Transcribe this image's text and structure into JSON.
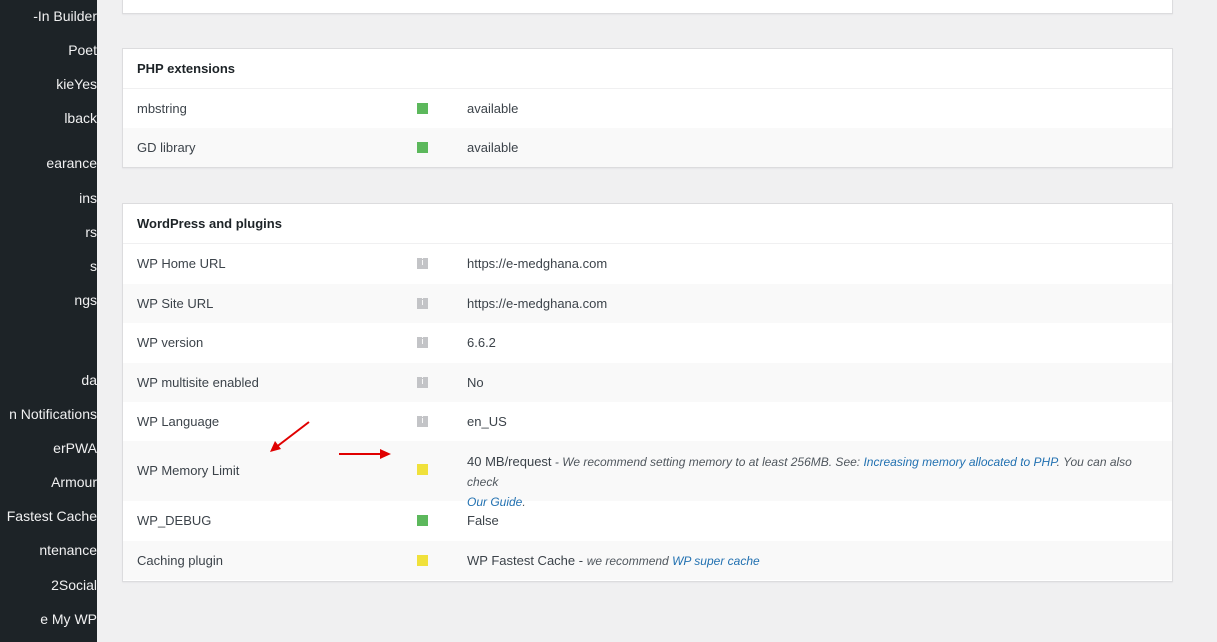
{
  "sidebar": {
    "items": [
      {
        "label": "-In Builder"
      },
      {
        "label": "Poet"
      },
      {
        "label": "kieYes"
      },
      {
        "label": "lback"
      },
      {
        "label": "earance"
      },
      {
        "label": "ins"
      },
      {
        "label": "rs"
      },
      {
        "label": "s"
      },
      {
        "label": "ngs"
      },
      {
        "label": "da"
      },
      {
        "label": "n Notifications"
      },
      {
        "label": "erPWA"
      },
      {
        "label": "Armour"
      },
      {
        "label": "Fastest Cache"
      },
      {
        "label": "ntenance"
      },
      {
        "label": "2Social"
      },
      {
        "label": "e My WP"
      }
    ]
  },
  "php_extensions": {
    "title": "PHP extensions",
    "rows": [
      {
        "label": "mbstring",
        "status": "green",
        "value": "available"
      },
      {
        "label": "GD library",
        "status": "green",
        "value": "available"
      }
    ]
  },
  "wordpress_plugins": {
    "title": "WordPress and plugins",
    "rows": [
      {
        "label": "WP Home URL",
        "status": "info",
        "value": "https://e-medghana.com"
      },
      {
        "label": "WP Site URL",
        "status": "info",
        "value": "https://e-medghana.com"
      },
      {
        "label": "WP version",
        "status": "info",
        "value": "6.6.2"
      },
      {
        "label": "WP multisite enabled",
        "status": "info",
        "value": "No"
      },
      {
        "label": "WP Language",
        "status": "info",
        "value": "en_US"
      },
      {
        "label": "WP Memory Limit",
        "status": "yellow",
        "value": "40 MB/request",
        "note_prefix": " - We recommend setting memory to at least 256MB. See: ",
        "link1": "Increasing memory allocated to PHP",
        "note_mid": ". You can also check",
        "link2": "Our Guide",
        "note_end": "."
      },
      {
        "label": "WP_DEBUG",
        "status": "green",
        "value": "False"
      },
      {
        "label": "Caching plugin",
        "status": "yellow",
        "value": "WP Fastest Cache",
        "note_prefix": " - ",
        "note_text": "we recommend ",
        "link1": "WP super cache"
      }
    ]
  },
  "info_glyph": "i",
  "colors": {
    "green": "#5cb85c",
    "yellow": "#f0e13b",
    "annotation_arrow": "#e00000"
  }
}
